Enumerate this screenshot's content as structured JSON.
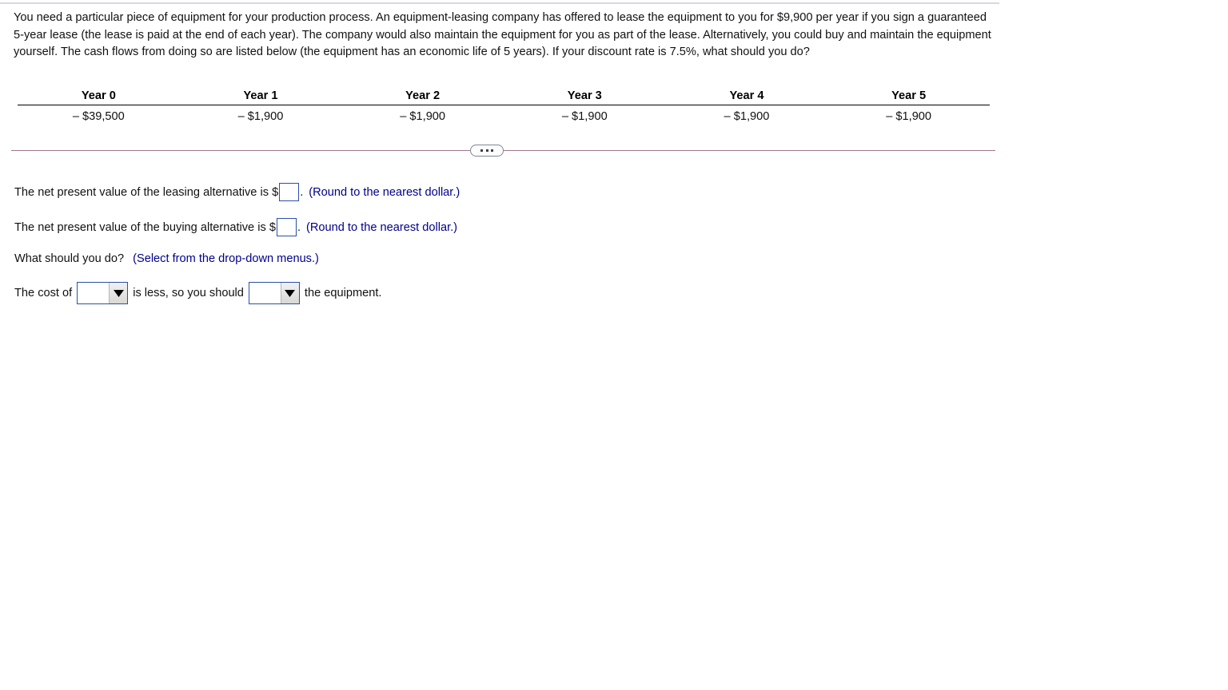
{
  "question": {
    "text": "You need a particular piece of equipment for your production process. An equipment-leasing company has offered to lease the equipment to you for $9,900 per year if you sign a guaranteed 5-year lease (the lease is paid at the end of each year). The company would also maintain the equipment for you as part of the lease. Alternatively, you could buy and maintain the equipment yourself. The cash flows from doing so are listed below (the equipment has an economic life of 5 years). If your discount rate is 7.5%, what should you do?"
  },
  "cash_flow_table": {
    "headers": [
      "Year 0",
      "Year 1",
      "Year 2",
      "Year 3",
      "Year 4",
      "Year 5"
    ],
    "values": [
      "– $39,500",
      "– $1,900",
      "– $1,900",
      "– $1,900",
      "– $1,900",
      "– $1,900"
    ]
  },
  "divider": {
    "expand_label": "•••",
    "name": "collapse-expand-toggle"
  },
  "answers": {
    "line1": {
      "prefix": "The net present value of the leasing alternative is $",
      "value": "",
      "suffix": ".",
      "hint": "(Round to the nearest dollar.)"
    },
    "line2": {
      "prefix": "The net present value of the buying alternative is $",
      "value": "",
      "suffix": ".",
      "hint": "(Round to the nearest dollar.)"
    },
    "line3": {
      "prompt": "What should you do?",
      "hint": "(Select from the drop-down menus.)"
    },
    "line4": {
      "prefix": "The cost of",
      "dropdown1_value": "",
      "middle": "is less, so you should",
      "dropdown2_value": "",
      "suffix": "the equipment."
    }
  },
  "colors": {
    "hint_blue": "#00008b",
    "input_border": "#2b4fa8",
    "divider_line": "#a0768c",
    "top_rule": "#d4d9e2"
  }
}
